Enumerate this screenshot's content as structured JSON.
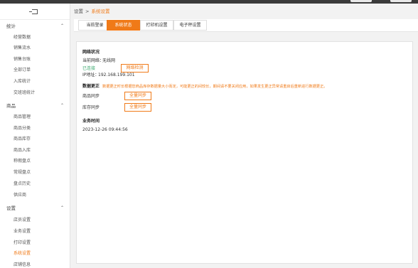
{
  "sidebar": {
    "sections": [
      {
        "label": "统计",
        "items": [
          "经营数据",
          "销售流水",
          "销售台账",
          "全部订单",
          "入库统计",
          "交班班统计"
        ]
      },
      {
        "label": "商品",
        "items": [
          "商品管理",
          "商品分类",
          "商品库存",
          "商品入库",
          "称假盘点",
          "常规盘点",
          "盘点历史",
          "供应商"
        ]
      },
      {
        "label": "设置",
        "items": [
          "店员设置",
          "业务设置",
          "打印设置",
          "系统设置",
          "店铺信息"
        ]
      }
    ],
    "active_item": "系统设置"
  },
  "breadcrumb": {
    "root": "设置",
    "separator": ">",
    "current": "系统设置"
  },
  "tabs": [
    "当前登录",
    "系统状态",
    "打印机设置",
    "电子秤设置"
  ],
  "active_tab": "系统状态",
  "network": {
    "title": "网络状况",
    "current_label": "当前网络：",
    "current_value": "无线网",
    "status": "已连接",
    "check_button": "网络检测",
    "ip_label": "IP地址：",
    "ip_value": "192.168.199.101"
  },
  "data_correction": {
    "title": "数据更正",
    "notice": "数据更正时长根据您商品库存数据量大小而定，可能更正的间较长，期间请不要关闭应用，如果发生更正异常请重启后重新进行数据更正。",
    "goods_sync_label": "商品同步",
    "stock_sync_label": "库存同步",
    "full_sync_button": "全量同步"
  },
  "business_time": {
    "title": "业务时间",
    "value": "2023-12-26 09:44:56"
  },
  "colors": {
    "accent": "#f07a18",
    "success": "#3aa76d"
  }
}
